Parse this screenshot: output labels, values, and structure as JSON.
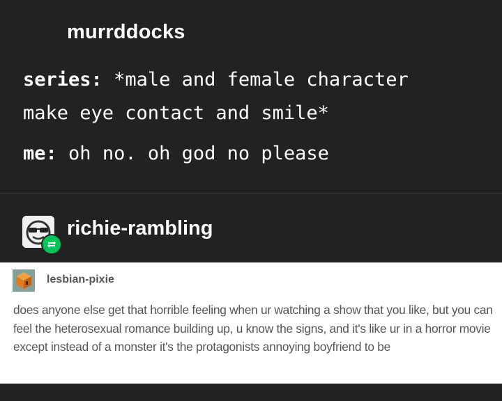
{
  "post": {
    "username": "murrddocks",
    "line1_label": "series:",
    "line1_text": "*male and female character",
    "line2_text": "make eye contact and smile*",
    "line3_label": "me:",
    "line3_text": "oh no. oh god no please"
  },
  "reblog": {
    "username": "richie-rambling"
  },
  "screenshot": {
    "username": "lesbian-pixie",
    "text": "does anyone else get that horrible feeling when ur watching a show that you like, but you can feel the heterosexual romance building up, u know the signs, and it's like ur in a horror movie except instead of a monster it's the protagonists annoying boyfriend to be"
  },
  "colors": {
    "background": "#222222",
    "reblog_badge": "#00c65a",
    "screenshot_bg": "#ffffff"
  },
  "icons": {
    "reblogger_avatar": "sunglasses-face-avatar",
    "reblog_badge": "reblog-icon",
    "pixie_avatar": "cube-avatar"
  }
}
